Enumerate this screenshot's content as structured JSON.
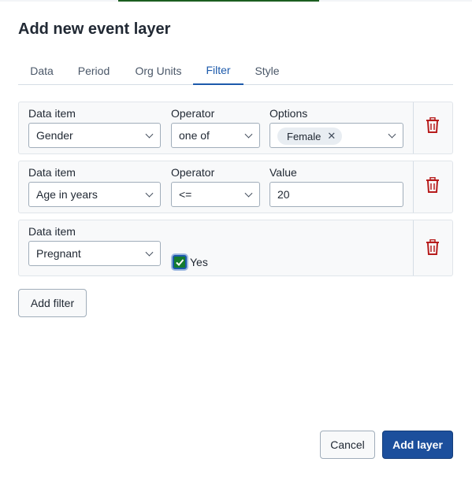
{
  "dialog": {
    "title": "Add new event layer"
  },
  "tabs": [
    {
      "label": "Data",
      "active": false
    },
    {
      "label": "Period",
      "active": false
    },
    {
      "label": "Org Units",
      "active": false
    },
    {
      "label": "Filter",
      "active": true
    },
    {
      "label": "Style",
      "active": false
    }
  ],
  "filters": [
    {
      "data_item_label": "Data item",
      "data_item_value": "Gender",
      "operator_label": "Operator",
      "operator_value": "one of",
      "options_label": "Options",
      "options_chips": [
        "Female"
      ]
    },
    {
      "data_item_label": "Data item",
      "data_item_value": "Age in years",
      "operator_label": "Operator",
      "operator_value": "<=",
      "value_label": "Value",
      "value_value": "20"
    },
    {
      "data_item_label": "Data item",
      "data_item_value": "Pregnant",
      "checkbox_label": "Yes",
      "checkbox_checked": true
    }
  ],
  "actions": {
    "add_filter": "Add filter",
    "cancel": "Cancel",
    "add_layer": "Add layer"
  },
  "colors": {
    "primary": "#1c4f9c",
    "active_tab": "#1c5aab",
    "delete_icon": "#b71c1c",
    "checkbox_fill": "#147b2e"
  },
  "icons": {
    "delete": "trash-icon",
    "dropdown": "chevron-down-icon",
    "chip_remove": "close-icon",
    "check": "checkmark-icon"
  }
}
